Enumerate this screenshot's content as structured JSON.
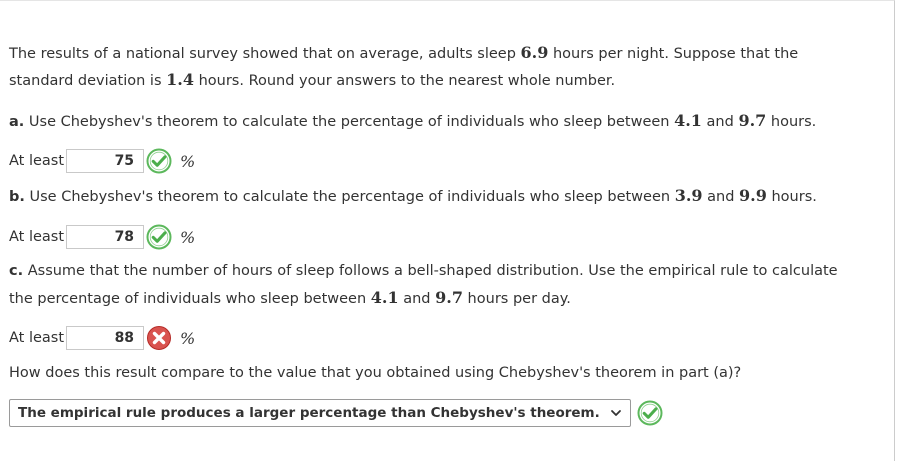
{
  "intro": {
    "t1": "The results of a national survey showed that on average, adults sleep ",
    "mean": "6.9",
    "t2": " hours per night. Suppose that the",
    "t3": "standard deviation is ",
    "sd": "1.4",
    "t4": " hours. Round your answers to the nearest whole number."
  },
  "part_a": {
    "letter": "a.",
    "t1": " Use Chebyshev's theorem to calculate the percentage of individuals who sleep between ",
    "low": "4.1",
    "t2": " and ",
    "high": "9.7",
    "t3": " hours.",
    "label": "At least",
    "answer": "75",
    "unit": "%",
    "status": "correct"
  },
  "part_b": {
    "letter": "b.",
    "t1": " Use Chebyshev's theorem to calculate the percentage of individuals who sleep between ",
    "low": "3.9",
    "t2": " and ",
    "high": "9.9",
    "t3": " hours.",
    "label": "At least",
    "answer": "78",
    "unit": "%",
    "status": "correct"
  },
  "part_c": {
    "letter": "c.",
    "t1": " Assume that the number of hours of sleep follows a bell-shaped distribution. Use the empirical rule to calculate",
    "t2": "the percentage of individuals who sleep between ",
    "low": "4.1",
    "t3": " and ",
    "high": "9.7",
    "t4": " hours per day.",
    "label": "At least",
    "answer": "88",
    "unit": "%",
    "status": "incorrect",
    "question": "How does this result compare to the value that you obtained using Chebyshev's theorem in part (a)?",
    "select_value": "The empirical rule produces a larger percentage than Chebyshev's theorem.",
    "select_status": "correct"
  },
  "colors": {
    "correct": "#5cb85c",
    "incorrect": "#d9534f",
    "text": "#333333"
  }
}
